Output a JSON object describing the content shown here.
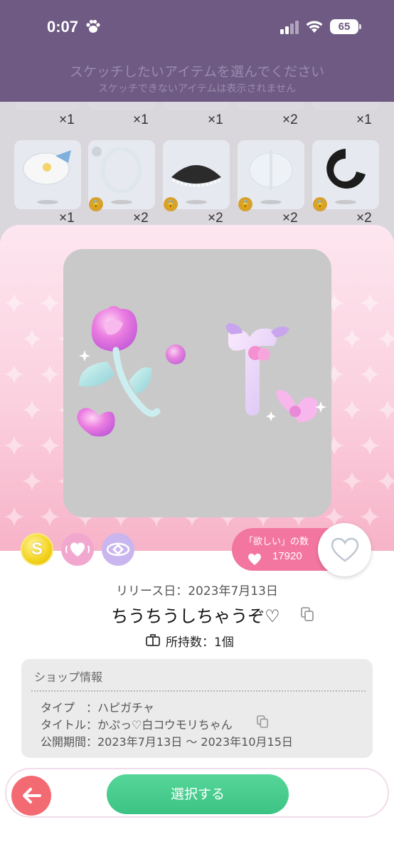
{
  "status_bar": {
    "time": "0:07",
    "battery": "65"
  },
  "header": {
    "title": "スケッチしたいアイテムを選んでください",
    "subtitle": "スケッチできないアイテムは表示されません"
  },
  "background_grid": {
    "row1_counts": [
      "×1",
      "×1",
      "×1",
      "×2",
      "×1"
    ],
    "row2_counts": [
      "×1",
      "×2",
      "×2",
      "×2",
      "×2"
    ]
  },
  "item": {
    "wish_label": "「欲しい」の数",
    "wish_count": "17920",
    "release": "リリース日：2023年7月13日",
    "name": "ちうちうしちゃうぞ♡",
    "owned": "所持数：1個"
  },
  "shop": {
    "title": "ショップ情報",
    "type": "タイプ　：ハピガチャ",
    "series_title": "タイトル：かぷっ♡白コウモリちゃん",
    "period": "公開期間：2023年7月13日 〜 2023年10月15日"
  },
  "actions": {
    "select_label": "選択する"
  },
  "colors": {
    "accent_pink": "#f2769f",
    "select_green": "#46c98b",
    "back_red": "#f46a72",
    "header_purple": "#6e5a83"
  }
}
